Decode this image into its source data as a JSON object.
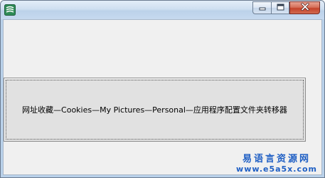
{
  "window": {
    "title": "",
    "icon": "app-icon",
    "controls": {
      "minimize_icon": "minimize-icon",
      "maximize_icon": "maximize-icon",
      "close_icon": "close-icon"
    }
  },
  "main_button": {
    "label": "网址收藏—Cookies—My Pictures—Personal—应用程序配置文件夹转移器"
  },
  "watermark": {
    "name": "易语言资源网",
    "url": "www.e5a5x.com"
  },
  "colors": {
    "close_button": "#c4432b",
    "watermark": "#1f5fc4",
    "client_background": "#f0f0f0"
  }
}
